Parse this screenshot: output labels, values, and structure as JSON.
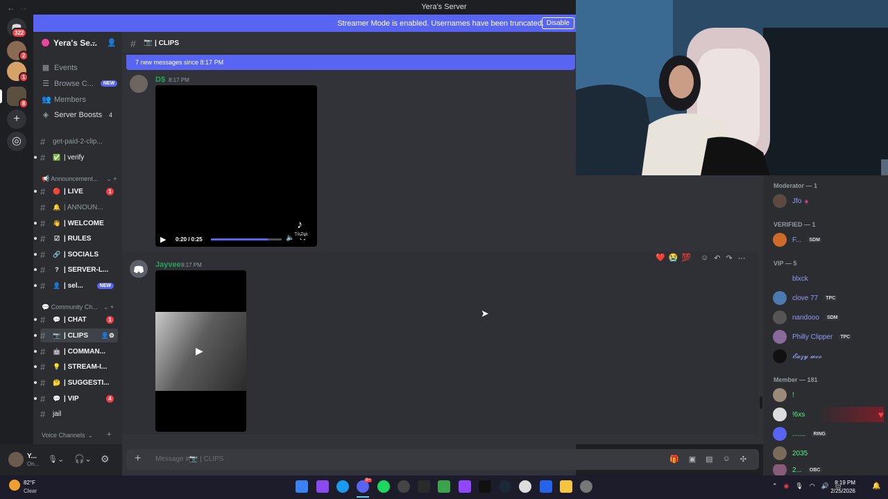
{
  "window": {
    "title": "Yera's Server",
    "back": "←",
    "forward": "→"
  },
  "rail": {
    "home_badge": "322",
    "server_badges": [
      "2",
      "1",
      "8"
    ]
  },
  "streamer_bar": {
    "message": "Streamer Mode is enabled. Usernames have been truncated.",
    "button": "Disable"
  },
  "server": {
    "name": "Yera's Se..."
  },
  "sidebar_top": [
    {
      "label": "Events",
      "icon": "calendar-icon"
    },
    {
      "label": "Browse C...",
      "badge": "NEW",
      "icon": "browse-icon"
    },
    {
      "label": "Members",
      "icon": "members-icon"
    },
    {
      "label": "Server Boosts",
      "count": "4",
      "icon": "boost-icon"
    }
  ],
  "channels": [
    {
      "name": "get-paid-2-clip...",
      "dim": true
    },
    {
      "name": "| verify",
      "emoji": "✅"
    }
  ],
  "category_announcements": "Announcement...",
  "channels2": [
    {
      "name": "| LIVE",
      "emoji": "🔴",
      "count": "1"
    },
    {
      "name": "| ANNOUN...",
      "emoji": "🔔",
      "dim": true
    },
    {
      "name": "| WELCOME",
      "emoji": "👋"
    },
    {
      "name": "| RULES",
      "emoji": "☑"
    },
    {
      "name": "| SOCIALS",
      "emoji": "🔗"
    },
    {
      "name": "| SERVER-L...",
      "emoji": "?"
    },
    {
      "name": "| sel...",
      "emoji": "👤",
      "badge": "NEW"
    }
  ],
  "category_community": "Community Ch...",
  "channels3": [
    {
      "name": "| CHAT",
      "emoji": "💬",
      "count": "1"
    },
    {
      "name": "| CLIPS",
      "emoji": "📷",
      "selected": true
    },
    {
      "name": "| COMMAN...",
      "emoji": "🤖"
    },
    {
      "name": "| STREAM-I...",
      "emoji": "💡"
    },
    {
      "name": "| SUGGESTI...",
      "emoji": "🤔"
    },
    {
      "name": "| VIP",
      "emoji": "💬",
      "count": "4"
    },
    {
      "name": "jail",
      "emoji": ""
    }
  ],
  "category_voice": "Voice Channels",
  "user": {
    "name": "Y...",
    "status": "On..."
  },
  "header": {
    "channel": "| CLIPS"
  },
  "new_messages": "7 new messages since 8:17 PM",
  "messages": [
    {
      "author": "D$",
      "time": "8:17 PM",
      "video_time": "0:20 / 0:25",
      "watermark": "TikTok"
    },
    {
      "author": "Jayvee",
      "time": "8:17 PM"
    }
  ],
  "reactions": [
    "❤️",
    "😭",
    "💯"
  ],
  "composer": {
    "placeholder": "Message #📷 | CLIPS"
  },
  "members": {
    "groups": [
      {
        "title": "Moderator — 1",
        "items": [
          {
            "name": "Jfo",
            "color": "#949cf7"
          }
        ]
      },
      {
        "title": "VERIFIED — 1",
        "items": [
          {
            "name": "F...",
            "color": "#949cf7",
            "tag": "SDM"
          }
        ]
      },
      {
        "title": "VIP — 5",
        "items": [
          {
            "name": "blxck",
            "color": "#949cf7"
          },
          {
            "name": "clove 77",
            "color": "#949cf7",
            "tag": "TPC"
          },
          {
            "name": "nandooo",
            "color": "#949cf7",
            "tag": "SDM"
          },
          {
            "name": "Philly Clipper",
            "color": "#949cf7",
            "tag": "TPC"
          },
          {
            "name": "𝓔𝓪𝔃𝔂 𝔀𝓸𝓸",
            "color": "#949cf7"
          }
        ]
      },
      {
        "title": "Member — 181",
        "items": [
          {
            "name": "!",
            "color": "#57f287"
          },
          {
            "name": "!6xs",
            "color": "#57f287"
          },
          {
            "name": ".......",
            "color": "#57f287",
            "tag": "RING"
          },
          {
            "name": "2035",
            "color": "#57f287"
          },
          {
            "name": "2...",
            "color": "#57f287",
            "tag": "OBC"
          }
        ]
      }
    ]
  },
  "taskbar": {
    "weather_temp": "82°F",
    "weather_desc": "Clear",
    "time": "8:19 PM",
    "date": "2/25/2026",
    "discord_badge": "9+"
  },
  "colors": {
    "blurple": "#5865f2",
    "green": "#23a55a",
    "red": "#f23f43"
  }
}
